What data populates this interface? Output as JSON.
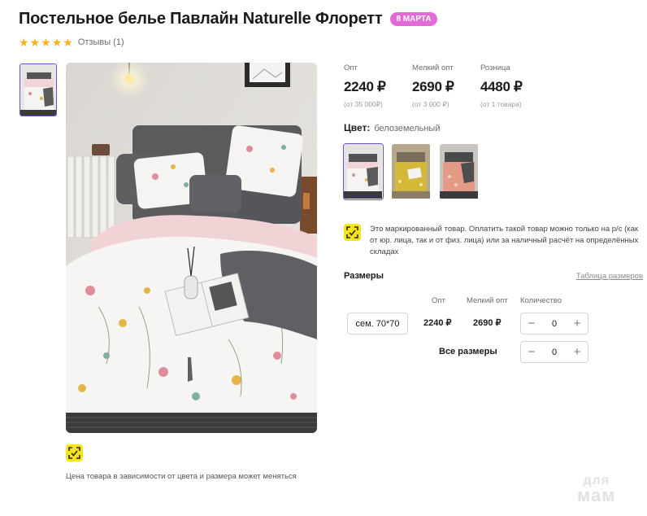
{
  "product": {
    "title": "Постельное белье Павлайн Naturelle Флоретт",
    "badge": "8 МАРТА",
    "rating_stars": 5,
    "reviews_label": "Отзывы (1)"
  },
  "prices": [
    {
      "label": "Опт",
      "value": "2240 ₽",
      "sub": "(от 35 000₽)"
    },
    {
      "label": "Мелкий опт",
      "value": "2690 ₽",
      "sub": "(от 3 000 ₽)"
    },
    {
      "label": "Розница",
      "value": "4480 ₽",
      "sub": "(от 1 товара)"
    }
  ],
  "color": {
    "label": "Цвет:",
    "value": "белоземельный",
    "swatch_names": [
      "белоземельный",
      "желтый",
      "розовый"
    ]
  },
  "marked_notice": "Это маркированный товар. Оплатить такой товар можно только на р/с (как от юр. лица, так и от физ. лица) или за наличный расчёт на определённых складах",
  "sizes": {
    "title": "Размеры",
    "table_link": "Таблица размеров",
    "columns": {
      "opt": "Опт",
      "small_opt": "Мелкий опт",
      "qty": "Количество"
    },
    "rows": [
      {
        "size": "сем. 70*70",
        "opt": "2240 ₽",
        "small_opt": "2690 ₽",
        "qty": "0"
      }
    ],
    "all_sizes_label": "Все размеры",
    "all_sizes_qty": "0"
  },
  "note": "Цена товара в зависимости от цвета и размера может меняться",
  "watermark": {
    "line1": "для",
    "line2": "мам"
  },
  "colors": {
    "accent": "#6a4fc9",
    "badge": "#e26ad6",
    "star": "#f6b21a",
    "marker": "#f4e418"
  }
}
